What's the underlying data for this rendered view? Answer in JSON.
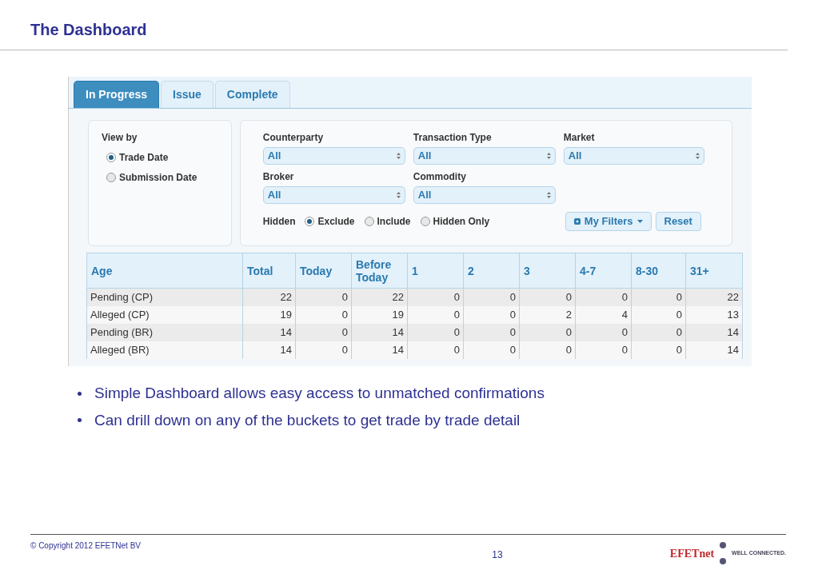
{
  "slide_title": "The Dashboard",
  "tabs": [
    {
      "label": "In Progress",
      "selected": true
    },
    {
      "label": "Issue",
      "selected": false
    },
    {
      "label": "Complete",
      "selected": false
    }
  ],
  "view_by": {
    "label": "View by",
    "options": [
      {
        "label": "Trade Date",
        "selected": true
      },
      {
        "label": "Submission Date",
        "selected": false
      }
    ]
  },
  "filters": [
    {
      "label": "Counterparty",
      "value": "All"
    },
    {
      "label": "Transaction Type",
      "value": "All"
    },
    {
      "label": "Market",
      "value": "All"
    },
    {
      "label": "Broker",
      "value": "All"
    },
    {
      "label": "Commodity",
      "value": "All"
    }
  ],
  "hidden": {
    "label": "Hidden",
    "options": [
      {
        "label": "Exclude",
        "selected": true
      },
      {
        "label": "Include",
        "selected": false
      },
      {
        "label": "Hidden Only",
        "selected": false
      }
    ]
  },
  "buttons": [
    {
      "label": "My Filters",
      "kind": "menu"
    },
    {
      "label": "Reset",
      "kind": "plain"
    }
  ],
  "table": {
    "columns": [
      "Age",
      "Total",
      "Today",
      "Before Today",
      "1",
      "2",
      "3",
      "4-7",
      "8-30",
      "31+"
    ],
    "rows": [
      [
        "Pending (CP)",
        "22",
        "0",
        "22",
        "0",
        "0",
        "0",
        "0",
        "0",
        "22"
      ],
      [
        "Alleged (CP)",
        "19",
        "0",
        "19",
        "0",
        "0",
        "2",
        "4",
        "0",
        "13"
      ],
      [
        "Pending (BR)",
        "14",
        "0",
        "14",
        "0",
        "0",
        "0",
        "0",
        "0",
        "14"
      ],
      [
        "Alleged (BR)",
        "14",
        "0",
        "14",
        "0",
        "0",
        "0",
        "0",
        "0",
        "14"
      ]
    ]
  },
  "bullets": [
    "Simple Dashboard allows easy access to unmatched confirmations",
    "Can drill down on any of the buckets to get trade by trade detail"
  ],
  "footer": {
    "copyright": "© Copyright 2012 EFETNet BV",
    "page": "13",
    "logo_name": "EFETnet",
    "logo_tagline": "WELL CONNECTED."
  }
}
